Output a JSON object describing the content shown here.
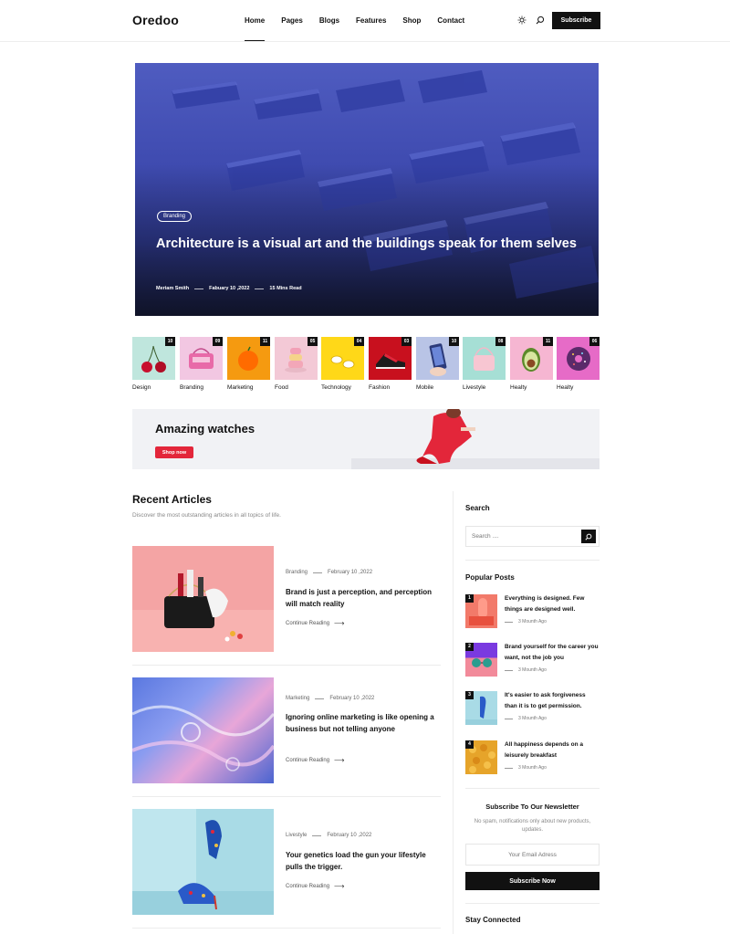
{
  "header": {
    "logo": "Oredoo",
    "nav": [
      "Home",
      "Pages",
      "Blogs",
      "Features",
      "Shop",
      "Contact"
    ],
    "subscribe_label": "Subscribe"
  },
  "hero": {
    "badge": "Branding",
    "title": "Architecture is a visual art and the buildings speak for them selves",
    "author": "Meriam Smith",
    "date": "Fabuary 10 ,2022",
    "read_time": "15 Mins Read"
  },
  "categories": [
    {
      "label": "Design",
      "count": "10"
    },
    {
      "label": "Branding",
      "count": "09"
    },
    {
      "label": "Marketing",
      "count": "11"
    },
    {
      "label": "Food",
      "count": "05"
    },
    {
      "label": "Technology",
      "count": "04"
    },
    {
      "label": "Fashion",
      "count": "03"
    },
    {
      "label": "Mobile",
      "count": "10"
    },
    {
      "label": "Livestyle",
      "count": "08"
    },
    {
      "label": "Healty",
      "count": "11"
    },
    {
      "label": "Healty",
      "count": "06"
    }
  ],
  "banner": {
    "title": "Amazing watches",
    "button": "Shop now"
  },
  "recent": {
    "title": "Recent Articles",
    "subtitle": "Discover the most outstanding articles in all topics of life.",
    "articles": [
      {
        "category": "Branding",
        "date": "February 10 ,2022",
        "title": "Brand is just a perception, and perception will match reality",
        "link": "Continue Reading"
      },
      {
        "category": "Marketing",
        "date": "February 10 ,2022",
        "title": "Ignoring online marketing is like opening a business but not telling anyone",
        "link": "Continue Reading"
      },
      {
        "category": "Livestyle",
        "date": "February 10 ,2022",
        "title": "Your genetics load the gun your lifestyle pulls the trigger.",
        "link": "Continue Reading"
      }
    ]
  },
  "sidebar": {
    "search_title": "Search",
    "search_placeholder": "Search ....",
    "popular_title": "Popular Posts",
    "popular": [
      {
        "num": "1",
        "title": "Everything is designed. Few things are designed well.",
        "time": "3 Mounth Ago"
      },
      {
        "num": "2",
        "title": "Brand yourself for the career you want, not the job you",
        "time": "3 Mounth Ago"
      },
      {
        "num": "3",
        "title": "It's easier to ask forgiveness than it is to get permission.",
        "time": "3 Mounth Ago"
      },
      {
        "num": "4",
        "title": "All happiness depends on a leisurely breakfast",
        "time": "3 Mounth Ago"
      }
    ],
    "newsletter_title": "Subscribe To Our Newsletter",
    "newsletter_sub": "No spam, notifications only about new products, updates.",
    "email_placeholder": "Your Email Adress",
    "newsletter_button": "Subscribe Now",
    "stay_connected": "Stay Connected"
  },
  "colors": {
    "accent": "#e3263a",
    "dark": "#111111",
    "hero_blue": "#3f4bb0"
  }
}
